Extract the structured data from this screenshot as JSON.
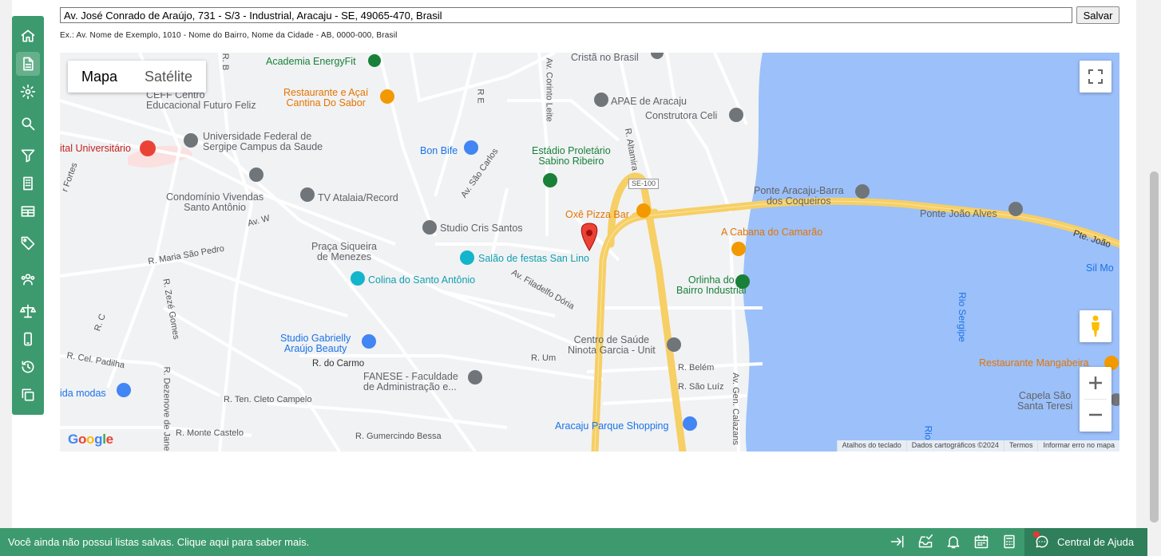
{
  "address": {
    "value": "Av. José Conrado de Araújo, 731 - S/3 - Industrial, Aracaju - SE, 49065-470, Brasil",
    "save_label": "Salvar",
    "hint": "Ex.: Av. Nome de Exemplo, 1010 - Nome do Bairro, Nome da Cidade - AB, 0000-000, Brasil"
  },
  "sidebar": {
    "icons": [
      "home-icon",
      "document-icon",
      "gear-icon",
      "search-icon",
      "filter-icon",
      "building-icon",
      "table-icon",
      "tag-icon",
      "users-icon",
      "scale-icon",
      "phone-icon",
      "history-icon",
      "copy-icon"
    ],
    "active_index": 1
  },
  "map": {
    "type_buttons": [
      "Mapa",
      "Satélite"
    ],
    "selected_type": "Mapa",
    "google": "Google",
    "attribution": [
      "Atalhos do teclado",
      "Dados cartográficos ©2024",
      "Termos",
      "Informar erro no mapa"
    ],
    "places": {
      "academia": "Academia EnergyFit",
      "cristo": "Cristã no Brasil",
      "restaurante_acai": "Restaurante e Açaí\nCantina Do Sabor",
      "ceff": "CEFF Centro\nEducacional Futuro Feliz",
      "apae": "APAE de Aracaju",
      "construtora": "Construtora Celi",
      "hospital": "ital Universitário",
      "ufs": "Universidade Federal de\nSergipe Campus da Saude",
      "bon_bife": "Bon Bife",
      "estadio": "Estádio Proletário\nSabino Ribeiro",
      "condominio": "Condomínio Vivendas\nSanto Antônio",
      "tv": "TV Atalaia/Record",
      "studio_cris": "Studio Cris Santos",
      "pizza": "Oxê Pizza Bar",
      "ponte_barra": "Ponte Aracaju-Barra\ndos Coqueiros",
      "ponte_joao": "Ponte João Alves",
      "cabana": "A Cabana do Camarão",
      "praca": "Praça Siqueira\nde Menezes",
      "salao": "Salão de festas San Lino",
      "colina": "Colina do Santo Antônio",
      "orlinha": "Orlinha do\nBairro Industrial",
      "studio_gab": "Studio Gabrielly\nAraújo Beauty",
      "centro_saude": "Centro de Saúde\nNinota Garcia - Unit",
      "fanese": "FANESE - Faculdade\nde Administração e...",
      "restaurante_mang": "Restaurante Mangabeira",
      "capela": "Capela São\nSanta Teresi",
      "aracaju_shop": "Aracaju Parque Shopping",
      "ida_modas": "ida modas",
      "sil_mo": "Sil Mo"
    },
    "streets": {
      "fortes": "r Fortes",
      "av_w": "Av. W",
      "maria_sp": "R. Maria São Pedro",
      "zeze": "R. Zezé Gomes",
      "rc": "R. C",
      "cel_padilha": "R. Cel. Padilha",
      "dezenove": "R. Dezenove de Jane",
      "ten_cleto": "R. Ten. Cleto Campelo",
      "monte_castelo": "R. Monte Castelo",
      "gumercindo": "R. Gumercindo Bessa",
      "do_carmo": "R. do Carmo",
      "r_um": "R. Um",
      "belem": "R. Belém",
      "sao_luiz": "R. São Luíz",
      "gen_calazans": "Av. Gen. Calazans",
      "filadelfo": "Av. Filadelfo Dória",
      "sao_carlos": "Av. São Carlos",
      "altamira": "R. Altamira",
      "corinto": "Av. Corinto Leite",
      "re": "R E",
      "rb": "R. B",
      "se100": "SE-100",
      "pte_joao": "Pte. João",
      "rio": "Rio Sergipe",
      "rio2": "Rio"
    }
  },
  "bottom_bar": {
    "message": "Você ainda não possui listas salvas. Clique aqui para saber mais.",
    "help_label": "Central de Ajuda",
    "icons": [
      "logout-icon",
      "inbox-check-icon",
      "bell-icon",
      "calendar-icon",
      "calculator-icon",
      "chat-help-icon"
    ]
  }
}
